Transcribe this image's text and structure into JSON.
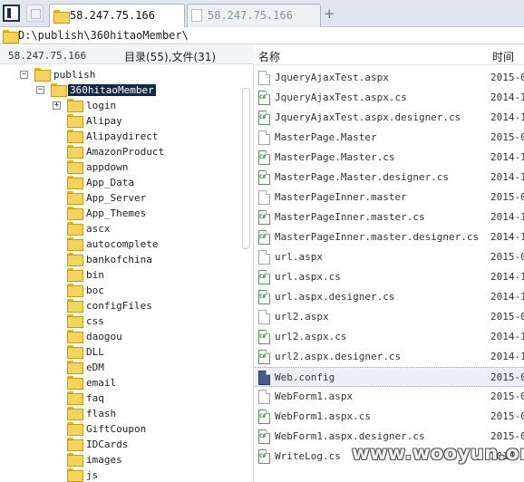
{
  "tabs": [
    {
      "label": "58.247.75.166",
      "active": true
    },
    {
      "label": "58.247.75.166",
      "active": false
    }
  ],
  "tab_add_label": "+",
  "path": "D:\\publish\\360hitaoMember\\",
  "left_header": {
    "server": "58.247.75.166",
    "counts": "目录(55),文件(31)"
  },
  "tree": [
    {
      "label": "publish",
      "expander": "−",
      "level": 0
    },
    {
      "label": "360hitaoMember",
      "expander": "−",
      "level": 1,
      "selected": true
    },
    {
      "label": "login",
      "expander": "+",
      "level": 2
    },
    {
      "label": "Alipay",
      "level": 2
    },
    {
      "label": "Alipaydirect",
      "level": 2
    },
    {
      "label": "AmazonProduct",
      "level": 2
    },
    {
      "label": "appdown",
      "level": 2
    },
    {
      "label": "App_Data",
      "level": 2
    },
    {
      "label": "App_Server",
      "level": 2
    },
    {
      "label": "App_Themes",
      "level": 2
    },
    {
      "label": "ascx",
      "level": 2
    },
    {
      "label": "autocomplete",
      "level": 2
    },
    {
      "label": "bankofchina",
      "level": 2
    },
    {
      "label": "bin",
      "level": 2
    },
    {
      "label": "boc",
      "level": 2
    },
    {
      "label": "configFiles",
      "level": 2
    },
    {
      "label": "css",
      "level": 2
    },
    {
      "label": "daogou",
      "level": 2
    },
    {
      "label": "DLL",
      "level": 2
    },
    {
      "label": "eDM",
      "level": 2
    },
    {
      "label": "email",
      "level": 2
    },
    {
      "label": "faq",
      "level": 2
    },
    {
      "label": "flash",
      "level": 2
    },
    {
      "label": "GiftCoupon",
      "level": 2
    },
    {
      "label": "IDCards",
      "level": 2
    },
    {
      "label": "images",
      "level": 2
    },
    {
      "label": "js",
      "level": 2
    }
  ],
  "columns": {
    "name": "名称",
    "time": "时间"
  },
  "files": [
    {
      "name": "JqueryAjaxTest.aspx",
      "time": "2015-0",
      "icon": "file"
    },
    {
      "name": "JqueryAjaxTest.aspx.cs",
      "time": "2014-1",
      "icon": "cs"
    },
    {
      "name": "JqueryAjaxTest.aspx.designer.cs",
      "time": "2014-1",
      "icon": "cs"
    },
    {
      "name": "MasterPage.Master",
      "time": "2015-0",
      "icon": "file"
    },
    {
      "name": "MasterPage.Master.cs",
      "time": "2014-1",
      "icon": "cs"
    },
    {
      "name": "MasterPage.Master.designer.cs",
      "time": "2014-1",
      "icon": "cs"
    },
    {
      "name": "MasterPageInner.master",
      "time": "2015-0",
      "icon": "file"
    },
    {
      "name": "MasterPageInner.master.cs",
      "time": "2014-1",
      "icon": "cs"
    },
    {
      "name": "MasterPageInner.master.designer.cs",
      "time": "2014-1",
      "icon": "cs"
    },
    {
      "name": "url.aspx",
      "time": "2015-0",
      "icon": "file"
    },
    {
      "name": "url.aspx.cs",
      "time": "2014-1",
      "icon": "cs"
    },
    {
      "name": "url.aspx.designer.cs",
      "time": "2014-1",
      "icon": "cs"
    },
    {
      "name": "url2.aspx",
      "time": "2015-0",
      "icon": "file"
    },
    {
      "name": "url2.aspx.cs",
      "time": "2014-1",
      "icon": "cs"
    },
    {
      "name": "url2.aspx.designer.cs",
      "time": "2014-1",
      "icon": "cs"
    },
    {
      "name": "Web.config",
      "time": "2015-0",
      "icon": "cfg",
      "highlighted": true
    },
    {
      "name": "WebForm1.aspx",
      "time": "2015-0",
      "icon": "file"
    },
    {
      "name": "WebForm1.aspx.cs",
      "time": "2015-0",
      "icon": "cs"
    },
    {
      "name": "WebForm1.aspx.designer.cs",
      "time": "2015-0",
      "icon": "cs"
    },
    {
      "name": "WriteLog.cs",
      "time": "2014-1",
      "icon": "cs"
    }
  ],
  "watermark": "www.wooyun.org",
  "colors": {
    "selection": "#14284a",
    "folder": "#f4d460",
    "tabbar": "#dfe6ee"
  }
}
